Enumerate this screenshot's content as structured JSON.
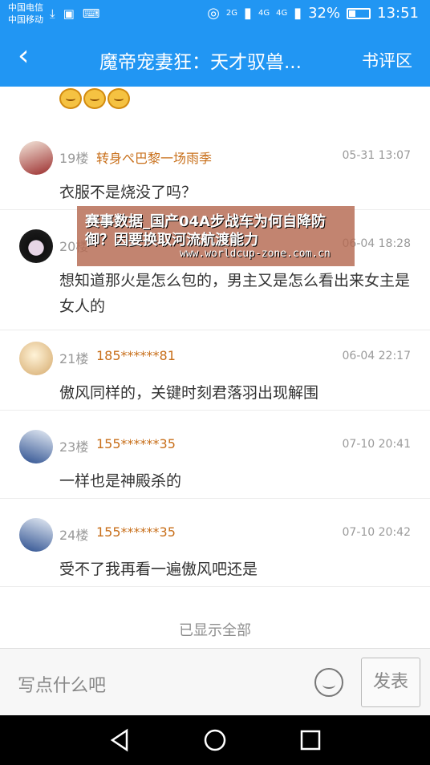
{
  "status_bar": {
    "carrier_1": "中国电信",
    "carrier_2": "中国移动",
    "net_1": "2G",
    "net_2": "4G",
    "net_3": "4G",
    "battery": "32%",
    "time": "13:51"
  },
  "app_bar": {
    "title": "魔帝宠妻狂：天才驭兽...",
    "action": "书评区"
  },
  "comments": [
    {
      "floor": "19楼",
      "name": "转身ぺ巴黎一场雨季",
      "time": "05-31 13:07",
      "text": "衣服不是烧没了吗？"
    },
    {
      "floor": "20楼",
      "name": "",
      "time": "06-04 18:28",
      "text": "想知道那火是怎么包的，男主又是怎么看出来女主是女人的"
    },
    {
      "floor": "21楼",
      "name": "185******81",
      "time": "06-04 22:17",
      "text": "傲风同样的，关键时刻君落羽出现解围"
    },
    {
      "floor": "23楼",
      "name": "155******35",
      "time": "07-10 20:41",
      "text": "一样也是神殿杀的"
    },
    {
      "floor": "24楼",
      "name": "155******35",
      "time": "07-10 20:42",
      "text": "受不了我再看一遍傲风吧还是"
    }
  ],
  "all_shown": "已显示全部",
  "input": {
    "placeholder": "写点什么吧",
    "send": "发表"
  },
  "watermark": {
    "title": "赛事数据_国产04A步战车为何自降防御？因要换取河流航渡能力",
    "url": "www.worldcup-zone.com.cn"
  },
  "icons": {
    "back": "back-arrow-icon",
    "emoji": "smile-icon",
    "nav": [
      "back-triangle-icon",
      "home-circle-icon",
      "recents-square-icon"
    ]
  },
  "colors": {
    "primary": "#2196f3",
    "username": "#c86f1a",
    "watermark_bg": "#b46950"
  }
}
